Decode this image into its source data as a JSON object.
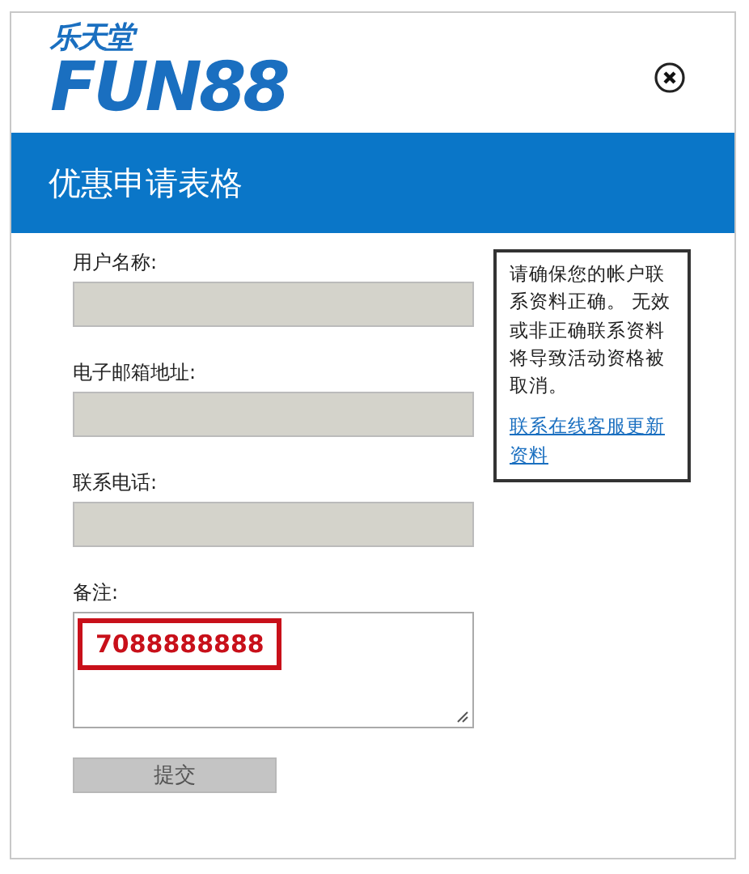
{
  "logo": {
    "chinese": "乐天堂",
    "latin": "FUN88"
  },
  "header": {
    "title": "优惠申请表格"
  },
  "fields": [
    {
      "label": "用户名称:",
      "disabled": true
    },
    {
      "label": "电子邮箱地址:",
      "disabled": true
    },
    {
      "label": "联系电话:",
      "disabled": true
    }
  ],
  "note": {
    "label": "备注:",
    "value": "7088888888",
    "highlighted": true
  },
  "submit": {
    "label": "提交",
    "disabled": true
  },
  "info": {
    "text": "请确保您的帐户联系资料正确。 无效或非正确联系资料将导致活动资格被取消。",
    "link": "联系在线客服更新资料"
  }
}
